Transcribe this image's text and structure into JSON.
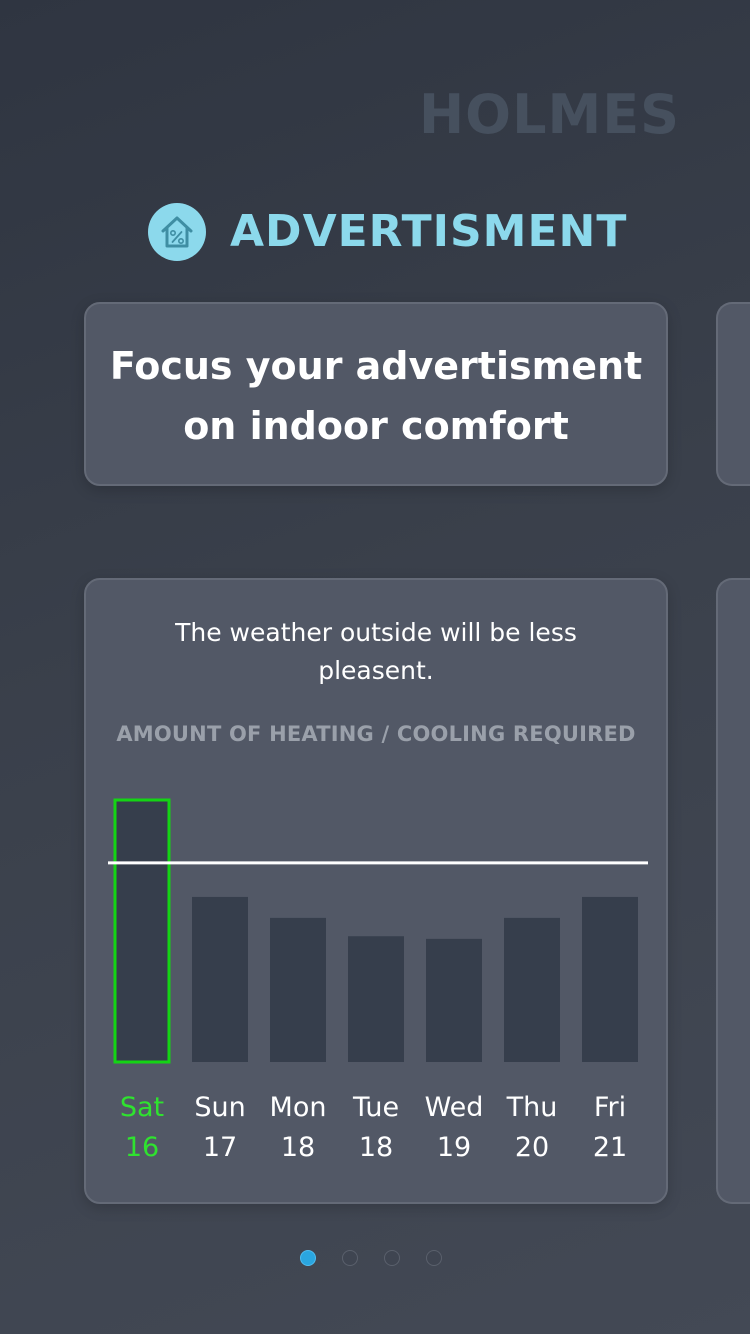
{
  "brand": "HOLMES",
  "section": {
    "icon": "house-percent-icon",
    "title": "ADVERTISMENT"
  },
  "headline_card": {
    "text": "Focus your advertisment on indoor comfort"
  },
  "weather_card": {
    "message": "The weather outside will be less pleasent.",
    "chart_title": "AMOUNT OF HEATING / COOLING REQUIRED"
  },
  "chart_data": {
    "type": "bar",
    "title": "AMOUNT OF HEATING / COOLING REQUIRED",
    "categories": [
      "Sat 16",
      "Sun 17",
      "Mon 18",
      "Tue 18",
      "Wed 19",
      "Thu 20",
      "Fri 21"
    ],
    "days": [
      {
        "day": "Sat",
        "date": "16"
      },
      {
        "day": "Sun",
        "date": "17"
      },
      {
        "day": "Mon",
        "date": "18"
      },
      {
        "day": "Tue",
        "date": "18"
      },
      {
        "day": "Wed",
        "date": "19"
      },
      {
        "day": "Thu",
        "date": "20"
      },
      {
        "day": "Fri",
        "date": "21"
      }
    ],
    "values": [
      100,
      63,
      55,
      48,
      47,
      55,
      63
    ],
    "reference_line": 76,
    "ylim": [
      0,
      100
    ],
    "selected_index": 0,
    "colors": {
      "bar": "#363e4c",
      "selected_outline": "#14d414",
      "selected_label": "#2fe22f",
      "reference_line": "#ffffff"
    }
  },
  "pagination": {
    "count": 4,
    "active_index": 0,
    "active_color": "#2aa6e0"
  }
}
